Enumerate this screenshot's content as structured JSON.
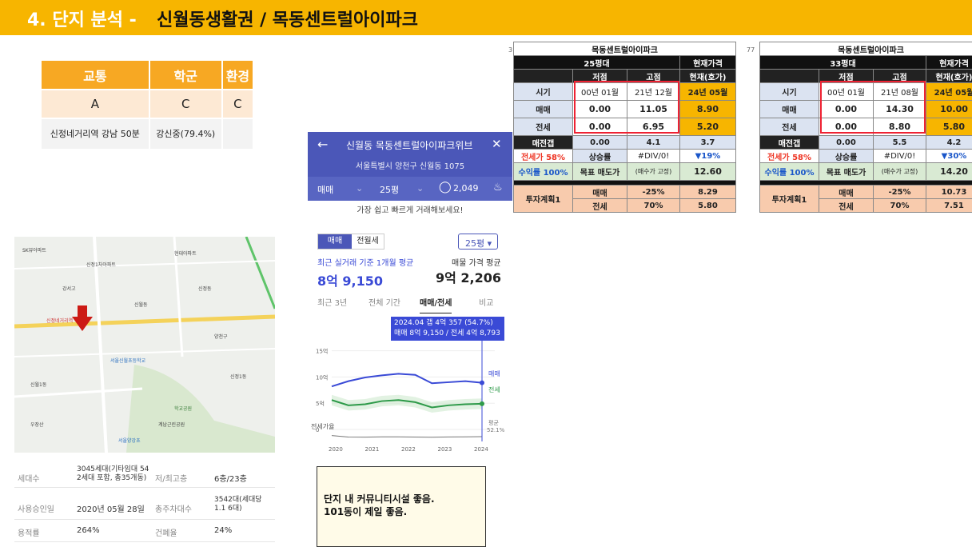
{
  "banner": {
    "prefix": "4. 단지 분석 -",
    "title": "신월동생활권 /  목동센트럴아이파크"
  },
  "grade_table": {
    "headers": [
      "교통",
      "학군",
      "환경"
    ],
    "grades": [
      "A",
      "C",
      "C"
    ],
    "details": [
      "신정네거리역 강남 50분",
      "강신중(79.4%)",
      ""
    ]
  },
  "apt_header": {
    "back_icon": "←",
    "name": "신월동 목동센트럴아이파크위브",
    "close_icon": "✕",
    "address": "서울특별시 양천구 신월동 1075",
    "tab_deal": "매매",
    "tab_size": "25평",
    "comment_count": "2,049",
    "bell_icon": "bell-icon",
    "subtitle": "가장 쉽고 빠르게 거래해보세요!"
  },
  "sheets": [
    {
      "row_number": "3",
      "title": "목동센트럴아이파크",
      "size": "25평대",
      "current_label": "현재가격",
      "cols": [
        "저점",
        "고점",
        "현재(호가)"
      ],
      "period_label": "시기",
      "periods": [
        "00년 01월",
        "21년 12월",
        "24년 05월"
      ],
      "sale_label": "매매",
      "sale": [
        "0.00",
        "11.05",
        "8.90"
      ],
      "jeonse_label": "전세",
      "jeonse": [
        "0.00",
        "6.95",
        "5.20"
      ],
      "gap_label": "매전갭",
      "gap": [
        "0.00",
        "4.1",
        "3.7"
      ],
      "ratio_label": "전세가 58%",
      "rise_label": "상승률",
      "rise": [
        "#DIV/0!",
        "▼19%"
      ],
      "yield_label": "수익률 100%",
      "target_label": "목표 매도가",
      "target_note": "(매수가 고정)",
      "target_value": "12.60",
      "plan_label": "투자계획1",
      "plan_sale": [
        "매매",
        "-25%",
        "8.29"
      ],
      "plan_jeonse": [
        "전세",
        "70%",
        "5.80"
      ]
    },
    {
      "row_number": "77",
      "title": "목동센트럴아이파크",
      "size": "33평대",
      "current_label": "현재가격",
      "cols": [
        "저점",
        "고점",
        "현재(호가)"
      ],
      "period_label": "시기",
      "periods": [
        "00년 01월",
        "21년 08월",
        "24년 05월"
      ],
      "sale_label": "매매",
      "sale": [
        "0.00",
        "14.30",
        "10.00"
      ],
      "jeonse_label": "전세",
      "jeonse": [
        "0.00",
        "8.80",
        "5.80"
      ],
      "gap_label": "매전갭",
      "gap": [
        "0.00",
        "5.5",
        "4.2"
      ],
      "ratio_label": "전세가 58%",
      "rise_label": "상승률",
      "rise": [
        "#DIV/0!",
        "▼30%"
      ],
      "yield_label": "수익률 100%",
      "target_label": "목표 매도가",
      "target_note": "(매수가 고정)",
      "target_value": "14.20",
      "plan_label": "투자계획1",
      "plan_sale": [
        "매매",
        "-25%",
        "10.73"
      ],
      "plan_jeonse": [
        "전세",
        "70%",
        "7.51"
      ]
    }
  ],
  "map": {
    "labels": [
      "SK뷰아파트",
      "신정1차아파트",
      "현대아파트",
      "신정네거리역",
      "신월동",
      "서울신월초등학교",
      "신월1동",
      "학교공원",
      "양천구",
      "신정1동",
      "강서고",
      "신정동",
      "우장산",
      "계남근린공원",
      "서울양강초"
    ]
  },
  "info": {
    "rows": [
      {
        "k1": "세대수",
        "v1": "3045세대(기타임대 54 2세대 포함, 총35개동)",
        "k2": "저/최고층",
        "v2": "6층/23층"
      },
      {
        "k1": "사용승인일",
        "v1": "2020년 05월 28일",
        "k2": "총주차대수",
        "v2": "3542대(세대당 1.1 6대)"
      },
      {
        "k1": "용적률",
        "v1": "264%",
        "k2": "건폐율",
        "v2": "24%"
      }
    ]
  },
  "chart_panel": {
    "seg_active": "매매",
    "seg_other": "전월세",
    "size_select": "25평 ▾",
    "recent_label": "최근 실거래 기준 1개월 평균",
    "recent_value": "8억 9,150",
    "ask_label": "매물 가격 평균",
    "ask_value": "9억 2,206",
    "range_tabs": [
      "최근 3년",
      "전체 기간",
      "매매/전세",
      "비교"
    ],
    "tooltip_line1": "2024.04  갭 4억 357 (54.7%)",
    "tooltip_line2": "매매 8억 9,150 / 전세 4억 8,793",
    "sale_series_label": "매매",
    "jeonse_series_label": "전세",
    "ratio_label": "전세가율",
    "ratio_end_label": "평균",
    "ratio_end_value": "52.1%"
  },
  "chart_data": {
    "type": "line",
    "x": [
      "2020",
      "2020.5",
      "2021",
      "2021.5",
      "2022",
      "2022.5",
      "2023",
      "2023.5",
      "2024",
      "2024.3"
    ],
    "xticks": [
      "2020",
      "2021",
      "2022",
      "2023",
      "2024"
    ],
    "yticks": [
      "15억",
      "10억",
      "5억",
      "0"
    ],
    "ylim": [
      0,
      16
    ],
    "series": [
      {
        "name": "매매",
        "values": [
          8.2,
          9.2,
          9.9,
          10.3,
          10.6,
          10.4,
          8.8,
          9.0,
          9.2,
          8.9
        ]
      },
      {
        "name": "전세",
        "values": [
          5.6,
          4.6,
          4.8,
          5.4,
          5.6,
          5.2,
          4.2,
          4.6,
          4.8,
          4.9
        ]
      }
    ],
    "colors": {
      "매매": "#3a4ad6",
      "전세": "#2e9a49",
      "ratio": "#777777"
    }
  },
  "memo": {
    "line1": "단지 내 커뮤니티시설 좋음.",
    "line2": "101동이 제일 좋음."
  }
}
